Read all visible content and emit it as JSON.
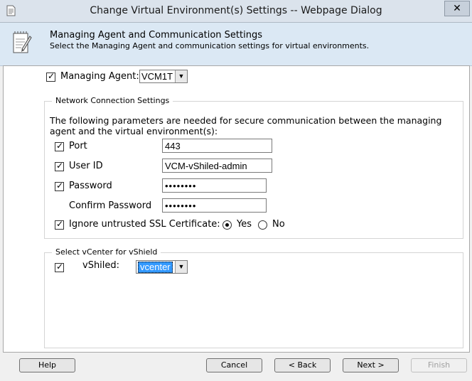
{
  "window": {
    "title": "Change Virtual Environment(s) Settings -- Webpage Dialog",
    "close_glyph": "✕",
    "icon": "document-icon"
  },
  "header": {
    "title": "Managing Agent and Communication Settings",
    "subtitle": "Select the Managing Agent and communication settings for virtual environments.",
    "icon": "notepad-pencil-icon"
  },
  "managing_agent": {
    "checked": true,
    "label": "Managing Agent:",
    "value": "VCM1T"
  },
  "network": {
    "legend": "Network Connection Settings",
    "intro": "The following parameters are needed for secure communication between the managing agent and the virtual environment(s):",
    "port": {
      "checked": true,
      "label": "Port",
      "value": "443"
    },
    "user_id": {
      "checked": true,
      "label": "User ID",
      "value": "VCM-vShiled-admin"
    },
    "password": {
      "checked": true,
      "label": "Password",
      "value": "••••••••"
    },
    "confirm_password": {
      "label": "Confirm Password",
      "value": "••••••••"
    },
    "ssl": {
      "checked": true,
      "label": "Ignore untrusted SSL Certificate:",
      "options": [
        "Yes",
        "No"
      ],
      "selected": "Yes"
    }
  },
  "vcenter": {
    "legend": "Select vCenter for vShield",
    "checked": true,
    "label": "vShiled:",
    "value": "vcenter"
  },
  "buttons": {
    "help": "Help",
    "cancel": "Cancel",
    "back": "< Back",
    "next": "Next >",
    "finish": "Finish"
  },
  "colors": {
    "header_bg": "#dbe8f4",
    "titlebar_bg": "#dbe3ec",
    "select_highlight": "#3399ff"
  }
}
